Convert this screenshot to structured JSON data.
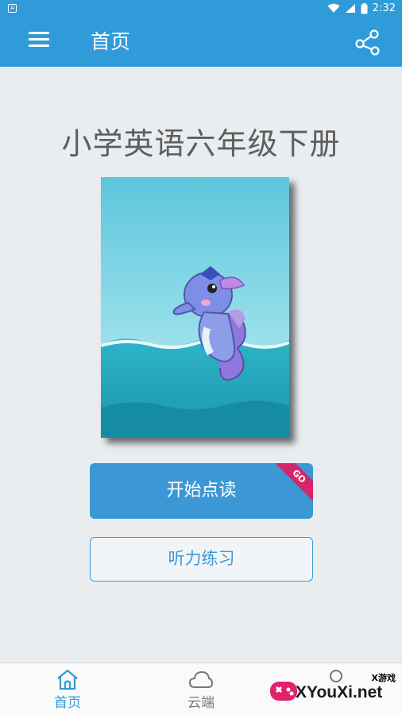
{
  "status_bar": {
    "left_icon": "A",
    "time": "2:32"
  },
  "app_bar": {
    "title": "首页",
    "menu_icon": "menu-icon",
    "share_icon": "share-icon"
  },
  "main": {
    "book_title": "小学英语六年级下册",
    "cover_image": "seahorse-cover",
    "start_button": {
      "label": "开始点读",
      "badge": "GO"
    },
    "listen_button": {
      "label": "听力练习"
    }
  },
  "bottom_nav": {
    "items": [
      {
        "label": "首页",
        "icon": "home-icon",
        "active": true
      },
      {
        "label": "云端",
        "icon": "cloud-icon",
        "active": false
      },
      {
        "label": "",
        "icon": "profile-icon",
        "active": false
      }
    ]
  },
  "watermark": {
    "small_text": "X游戏",
    "brand": "XYouXi.net"
  },
  "colors": {
    "primary": "#2f9bd8",
    "button": "#3c98d4",
    "badge": "#d6256a",
    "title_text": "#5e5e5e"
  }
}
